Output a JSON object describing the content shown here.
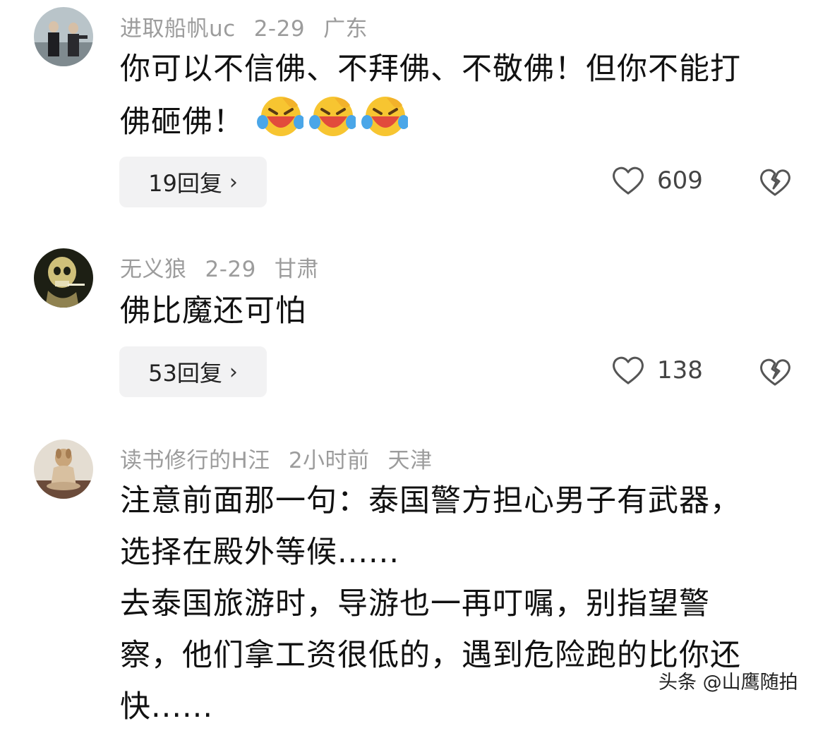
{
  "comments": [
    {
      "username": "进取船帆uc",
      "date": "2-29",
      "location": "广东",
      "text": "你可以不信佛、不拜佛、不敬佛！但你不能打\n佛砸佛！",
      "emoji_count": 3,
      "emoji_name": "laughing-crying-emoji",
      "replies": "19回复",
      "likes": "609"
    },
    {
      "username": "无义狼",
      "date": "2-29",
      "location": "甘肃",
      "text": "佛比魔还可怕",
      "replies": "53回复",
      "likes": "138"
    },
    {
      "username": "读书修行的H汪",
      "date": "2小时前",
      "location": "天津",
      "text": "注意前面那一句：泰国警方担心男子有武器，\n选择在殿外等候......\n去泰国旅游时，导游也一再叮嘱，别指望警\n察，他们拿工资很低的，遇到危险跑的比你还\n快......"
    }
  ],
  "reply_chevron": "›",
  "icons": {
    "like": "heart-outline-icon",
    "dislike": "broken-heart-icon"
  },
  "watermark": "头条 @山鹰随拍"
}
